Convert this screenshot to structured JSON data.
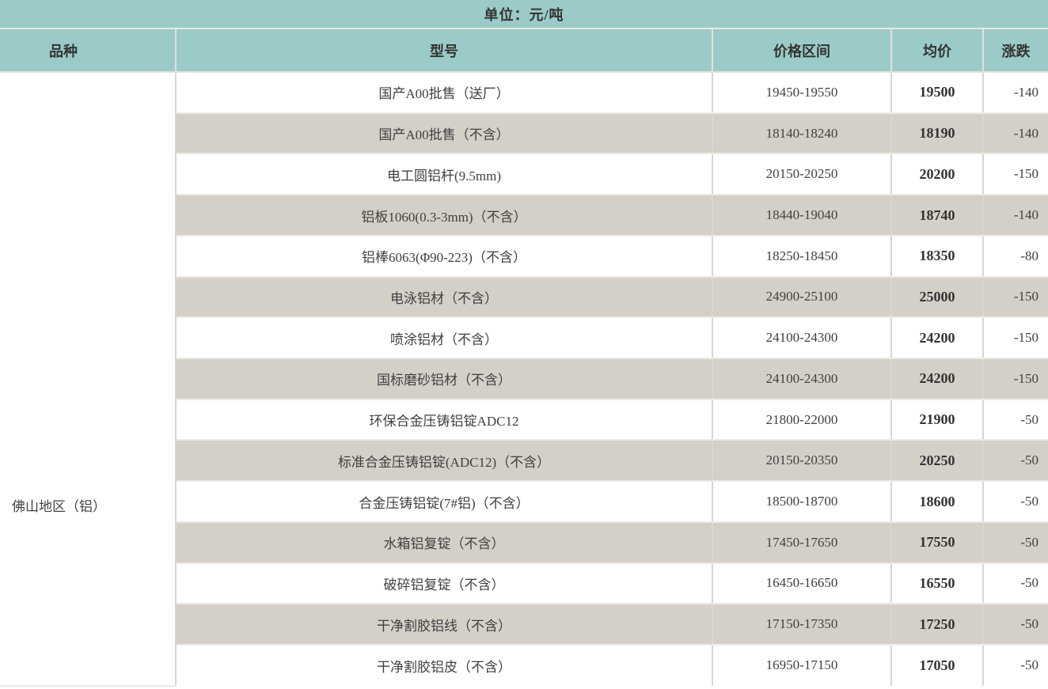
{
  "unit_label": "单位：元/吨",
  "colors": {
    "header_bg": "#9bcbc8",
    "alt_row_bg": "#d4d0c8",
    "text": "#404040"
  },
  "chart_data": {
    "type": "table",
    "title": "单位：元/吨",
    "columns": [
      "品种",
      "型号",
      "价格区间",
      "均价",
      "涨跌"
    ],
    "region": "佛山地区（铝）",
    "rows": [
      {
        "model": "国产A00批售（送厂）",
        "price_range": "19450-19550",
        "avg_price": 19500,
        "change": -140
      },
      {
        "model": "国产A00批售（不含）",
        "price_range": "18140-18240",
        "avg_price": 18190,
        "change": -140
      },
      {
        "model": "电工圆铝杆(9.5mm)",
        "price_range": "20150-20250",
        "avg_price": 20200,
        "change": -150
      },
      {
        "model": "铝板1060(0.3-3mm)（不含）",
        "price_range": "18440-19040",
        "avg_price": 18740,
        "change": -140
      },
      {
        "model": "铝棒6063(Φ90-223)（不含）",
        "price_range": "18250-18450",
        "avg_price": 18350,
        "change": -80
      },
      {
        "model": "电泳铝材（不含）",
        "price_range": "24900-25100",
        "avg_price": 25000,
        "change": -150
      },
      {
        "model": "喷涂铝材（不含）",
        "price_range": "24100-24300",
        "avg_price": 24200,
        "change": -150
      },
      {
        "model": "国标磨砂铝材（不含）",
        "price_range": "24100-24300",
        "avg_price": 24200,
        "change": -150
      },
      {
        "model": "环保合金压铸铝锭ADC12",
        "price_range": "21800-22000",
        "avg_price": 21900,
        "change": -50
      },
      {
        "model": "标准合金压铸铝锭(ADC12)（不含）",
        "price_range": "20150-20350",
        "avg_price": 20250,
        "change": -50
      },
      {
        "model": "合金压铸铝锭(7#铝)（不含）",
        "price_range": "18500-18700",
        "avg_price": 18600,
        "change": -50
      },
      {
        "model": "水箱铝复锭（不含）",
        "price_range": "17450-17650",
        "avg_price": 17550,
        "change": -50
      },
      {
        "model": "破碎铝复锭（不含）",
        "price_range": "16450-16650",
        "avg_price": 16550,
        "change": -50
      },
      {
        "model": "干净割胶铝线（不含）",
        "price_range": "17150-17350",
        "avg_price": 17250,
        "change": -50
      },
      {
        "model": "干净割胶铝皮（不含）",
        "price_range": "16950-17150",
        "avg_price": 17050,
        "change": -50
      }
    ]
  }
}
